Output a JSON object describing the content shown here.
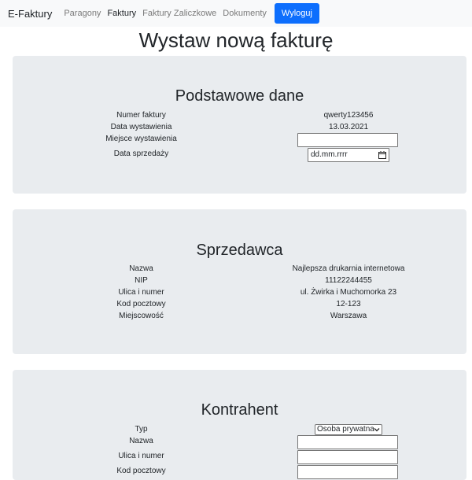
{
  "navbar": {
    "brand": "E-Faktury",
    "links": [
      "Paragony",
      "Faktury",
      "Faktury Zaliczkowe",
      "Dokumenty"
    ],
    "logout": "Wyloguj"
  },
  "page_title": "Wystaw nową fakturę",
  "basic": {
    "heading": "Podstawowe dane",
    "invoice_number_label": "Numer faktury",
    "invoice_number": "qwerty123456",
    "issue_date_label": "Data wystawienia",
    "issue_date": "13.03.2021",
    "issue_place_label": "Miejsce wystawienia",
    "issue_place": "",
    "sale_date_label": "Data sprzedaży",
    "sale_date_placeholder": "dd.mm.rrrr"
  },
  "seller": {
    "heading": "Sprzedawca",
    "name_label": "Nazwa",
    "name": "Najlepsza drukarnia internetowa",
    "nip_label": "NIP",
    "nip": "11122244455",
    "street_label": "Ulica i numer",
    "street": "ul. Żwirka i Muchomorka 23",
    "postal_label": "Kod pocztowy",
    "postal": "12-123",
    "city_label": "Miejscowość",
    "city": "Warszawa"
  },
  "contractor": {
    "heading": "Kontrahent",
    "type_label": "Typ",
    "type_value": "Osoba prywatna",
    "name_label": "Nazwa",
    "name": "",
    "street_label": "Ulica i numer",
    "street": "",
    "postal_label": "Kod pocztowy",
    "postal": ""
  },
  "colors": {
    "primary": "#0d6efd",
    "panel": "#e9ecef",
    "navbar": "#f8f9fa"
  }
}
